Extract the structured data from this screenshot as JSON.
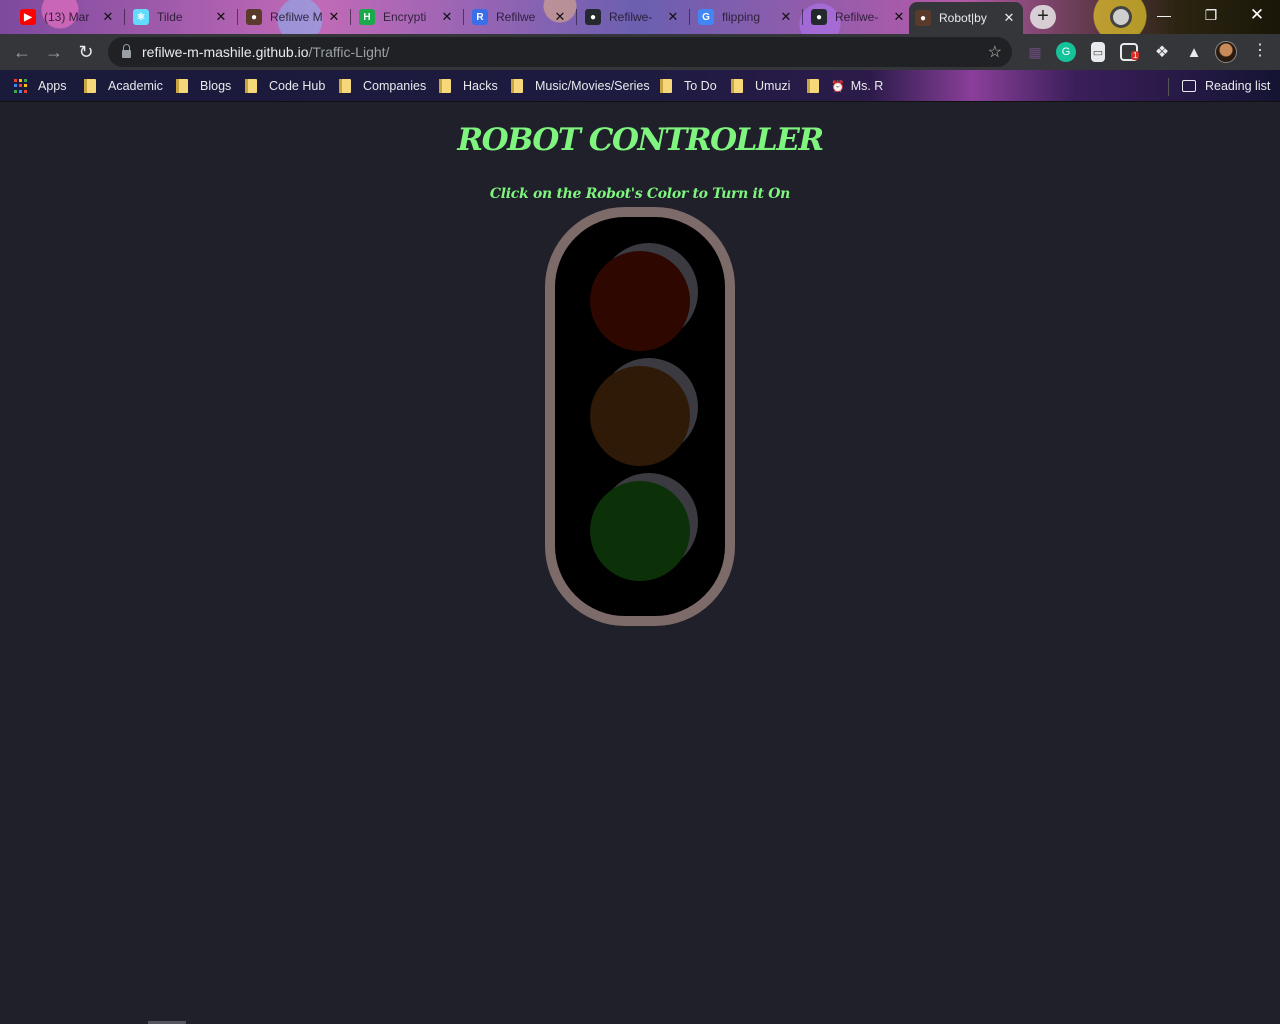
{
  "browser": {
    "tabs": [
      {
        "title": "(13) Mar",
        "favicon": "youtube-icon",
        "color": "#ff0000",
        "glyph": "▶"
      },
      {
        "title": "Tilde",
        "favicon": "react-icon",
        "color": "#61dafb",
        "glyph": "⚛"
      },
      {
        "title": "Refilwe M",
        "favicon": "avatar-icon",
        "color": "#5a3a2a",
        "glyph": "●"
      },
      {
        "title": "Encrypti",
        "favicon": "hackerrank-icon",
        "color": "#1ba94c",
        "glyph": "H"
      },
      {
        "title": "Refilwe",
        "favicon": "r-icon",
        "color": "#3a6ee8",
        "glyph": "R"
      },
      {
        "title": "Refilwe-",
        "favicon": "github-icon",
        "color": "#24292e",
        "glyph": "●"
      },
      {
        "title": "flipping",
        "favicon": "google-icon",
        "color": "#4285f4",
        "glyph": "G"
      },
      {
        "title": "Refilwe-",
        "favicon": "github-icon",
        "color": "#24292e",
        "glyph": "●"
      },
      {
        "title": "Robot|by",
        "favicon": "avatar-icon",
        "color": "#5a3a2a",
        "glyph": "●",
        "active": true
      }
    ],
    "new_tab_label": "+",
    "url_host": "refilwe-m-mashile.github.io",
    "url_path": "/Traffic-Light/",
    "extension_badge": "1",
    "bookmarks": [
      {
        "label": "Apps",
        "type": "apps"
      },
      {
        "label": "Academic",
        "type": "folder"
      },
      {
        "label": "Blogs",
        "type": "folder"
      },
      {
        "label": "Code Hub",
        "type": "folder"
      },
      {
        "label": "Companies",
        "type": "folder"
      },
      {
        "label": "Hacks",
        "type": "folder"
      },
      {
        "label": "Music/Movies/Series",
        "type": "folder"
      },
      {
        "label": "To Do",
        "type": "folder"
      },
      {
        "label": "Umuzi",
        "type": "folder"
      },
      {
        "label": "Ms. R",
        "type": "alarm"
      }
    ],
    "reading_list": "Reading list"
  },
  "page": {
    "title": "ROBOT CONTROLLER",
    "subtitle": "Click on the Robot's Color to Turn it On",
    "lights": [
      {
        "name": "red",
        "color": "#2e0700",
        "state": "off"
      },
      {
        "name": "yellow",
        "color": "#2e1a07",
        "state": "off"
      },
      {
        "name": "green",
        "color": "#0c3007",
        "state": "off"
      }
    ],
    "title_color": "#7ff57f",
    "background": "#20202a",
    "housing_border": "#7d6b69"
  }
}
